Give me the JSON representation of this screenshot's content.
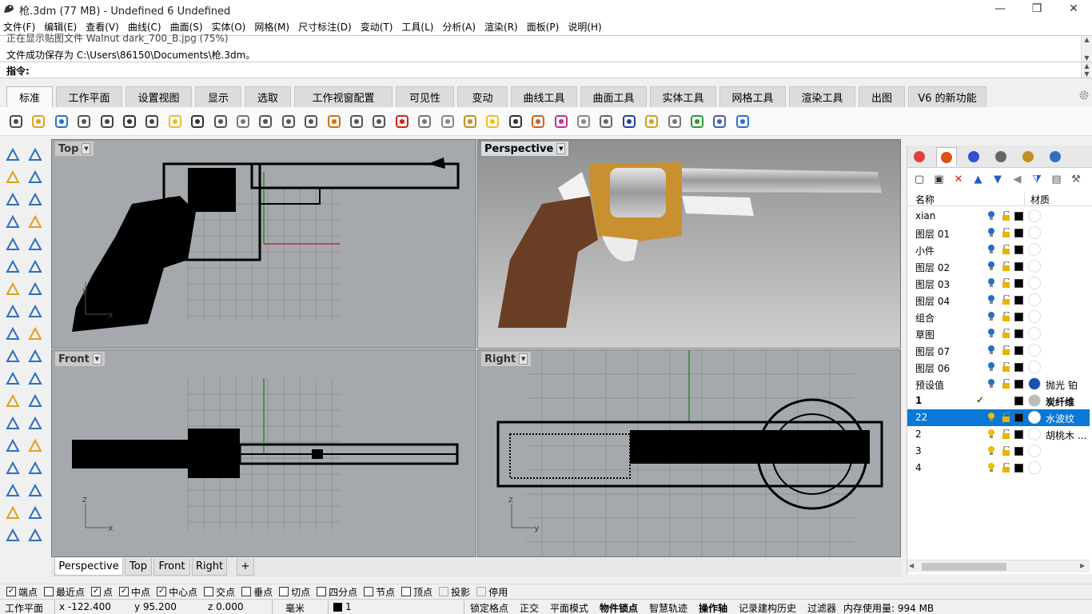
{
  "window": {
    "title": "枪.3dm (77 MB) - Undefined 6 Undefined",
    "minimize": "—",
    "restore": "❐",
    "close": "✕"
  },
  "menu": [
    "文件(F)",
    "编辑(E)",
    "查看(V)",
    "曲线(C)",
    "曲面(S)",
    "实体(O)",
    "网格(M)",
    "尺寸标注(D)",
    "变动(T)",
    "工具(L)",
    "分析(A)",
    "渲染(R)",
    "面板(P)",
    "说明(H)"
  ],
  "command": {
    "history_line1": "正在显示贴图文件 Walnut dark_700_B.jpg (75%)",
    "history_line2": "文件成功保存为 C:\\Users\\86150\\Documents\\枪.3dm。",
    "prompt_label": "指令:",
    "input_value": ""
  },
  "tabs": [
    "标准",
    "工作平面",
    "设置视图",
    "显示",
    "选取",
    "工作视窗配置",
    "可见性",
    "变动",
    "曲线工具",
    "曲面工具",
    "实体工具",
    "网格工具",
    "渲染工具",
    "出图",
    "V6 的新功能"
  ],
  "active_tab": "标准",
  "toolbar_icons": [
    "new-file-icon",
    "open-file-icon",
    "save-icon",
    "print-icon",
    "import-icon",
    "cut-icon",
    "copy-icon",
    "paste-icon",
    "undo-icon",
    "pan-icon",
    "move-view-icon",
    "zoom-icon",
    "zoom-window-icon",
    "zoom-extents-icon",
    "zoom-selected-icon",
    "rotate-view-icon",
    "four-views-icon",
    "car-icon",
    "named-views-icon",
    "construction-plane-icon",
    "cplane-icon",
    "light-bulb-icon",
    "lock-icon",
    "layer-icon",
    "color-wheel-icon",
    "shade-icon",
    "rendered-icon",
    "material-ball-icon",
    "render-icon",
    "options-icon",
    "grasshopper-icon",
    "python-icon",
    "help-icon"
  ],
  "viewports": {
    "top": {
      "label": "Top",
      "axis_y": "y",
      "axis_x": "x"
    },
    "perspective": {
      "label": "Perspective"
    },
    "front": {
      "label": "Front",
      "axis_y": "z",
      "axis_x": "x"
    },
    "right": {
      "label": "Right",
      "axis_y": "z",
      "axis_x": "y"
    }
  },
  "viewport_tabs": [
    "Perspective",
    "Top",
    "Front",
    "Right"
  ],
  "viewport_add": "+",
  "panel": {
    "col_name": "名称",
    "col_material": "材质",
    "layers": [
      {
        "name": "xian",
        "check": "",
        "bulb": "#1e70c8",
        "material": "",
        "matcolor": "#ffffff"
      },
      {
        "name": "图层 01",
        "check": "",
        "bulb": "#1e70c8",
        "material": "",
        "matcolor": "#ffffff"
      },
      {
        "name": "小件",
        "check": "",
        "bulb": "#1e70c8",
        "material": "",
        "matcolor": "#ffffff"
      },
      {
        "name": "图层 02",
        "check": "",
        "bulb": "#1e70c8",
        "material": "",
        "matcolor": "#ffffff"
      },
      {
        "name": "图层 03",
        "check": "",
        "bulb": "#1e70c8",
        "material": "",
        "matcolor": "#ffffff"
      },
      {
        "name": "图层 04",
        "check": "",
        "bulb": "#1e70c8",
        "material": "",
        "matcolor": "#ffffff"
      },
      {
        "name": "组合",
        "check": "",
        "bulb": "#1e70c8",
        "material": "",
        "matcolor": "#ffffff"
      },
      {
        "name": "草图",
        "check": "",
        "bulb": "#1e70c8",
        "material": "",
        "matcolor": "#ffffff"
      },
      {
        "name": "图层 07",
        "check": "",
        "bulb": "#1e70c8",
        "material": "",
        "matcolor": "#ffffff"
      },
      {
        "name": "图层 06",
        "check": "",
        "bulb": "#1e70c8",
        "material": "",
        "matcolor": "#ffffff"
      },
      {
        "name": "预设值",
        "check": "",
        "bulb": "#1e70c8",
        "material": "抛光 铂",
        "matcolor": "#1a4fb4"
      },
      {
        "name": "1",
        "check": "✓",
        "bulb": "",
        "material": "炭纤维",
        "matcolor": "#bbbbbb"
      },
      {
        "name": "22",
        "check": "",
        "bulb": "#e8c000",
        "material": "水波纹",
        "matcolor": "#ffffff"
      },
      {
        "name": "2",
        "check": "",
        "bulb": "#e8c000",
        "material": "胡桃木 ...",
        "matcolor": "#ffffff"
      },
      {
        "name": "3",
        "check": "",
        "bulb": "#e8c000",
        "material": "",
        "matcolor": "#ffffff"
      },
      {
        "name": "4",
        "check": "",
        "bulb": "#e8c000",
        "material": "",
        "matcolor": "#ffffff"
      }
    ],
    "selected_layer": "22"
  },
  "osnap": [
    {
      "label": "端点",
      "checked": true
    },
    {
      "label": "最近点",
      "checked": false
    },
    {
      "label": "点",
      "checked": true
    },
    {
      "label": "中点",
      "checked": true
    },
    {
      "label": "中心点",
      "checked": true
    },
    {
      "label": "交点",
      "checked": false
    },
    {
      "label": "垂点",
      "checked": false
    },
    {
      "label": "切点",
      "checked": false
    },
    {
      "label": "四分点",
      "checked": false
    },
    {
      "label": "节点",
      "checked": false
    },
    {
      "label": "顶点",
      "checked": false
    },
    {
      "label": "投影",
      "checked": false,
      "disabled": true
    },
    {
      "label": "停用",
      "checked": false,
      "disabled": true
    }
  ],
  "status": {
    "cplane": "工作平面",
    "x": "x -122.400",
    "y": "y 95.200",
    "z": "z 0.000",
    "unit": "毫米",
    "layer": "1",
    "grid_snap": "锁定格点",
    "ortho": "正交",
    "planar": "平面模式",
    "osnap": "物件锁点",
    "smarttrack": "智慧轨迹",
    "gumball": "操作轴",
    "history": "记录建构历史",
    "filter": "过滤器",
    "memory": "内存使用量: 994 MB"
  },
  "colors": {
    "accent": "#0a78d6",
    "viewport_bg": "#a5a9ad",
    "wood_light": "#c8902e",
    "wood_dark": "#6a3e24"
  }
}
